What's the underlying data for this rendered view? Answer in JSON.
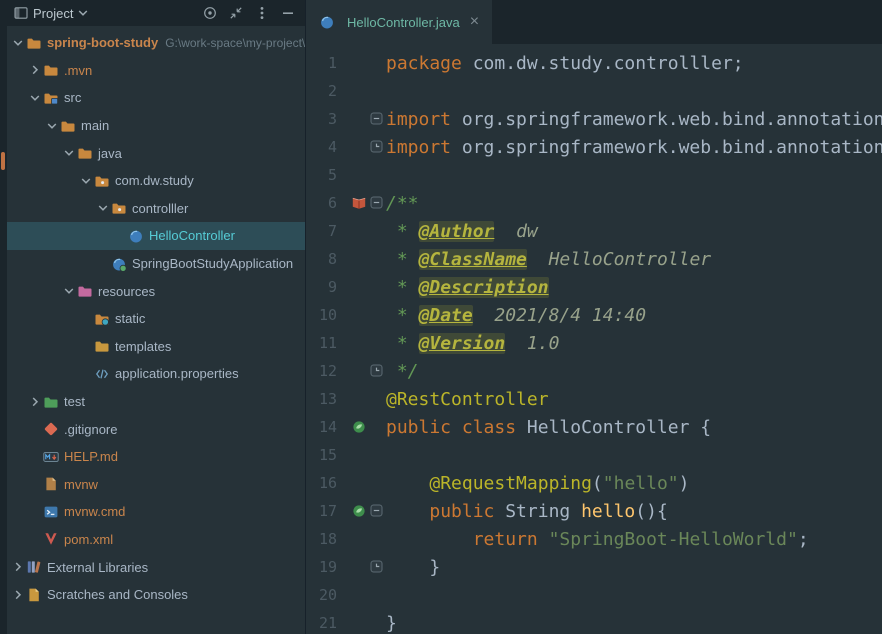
{
  "colors": {
    "keyword": "#CC7832",
    "string": "#6A8759",
    "annotation": "#BBB529",
    "comment": "#629755",
    "selection_bg": "#2D4D57",
    "selected_text": "#56CCD6",
    "orange_item": "#C9854C",
    "tab_title": "#6EB8A5",
    "editor_bg": "#263238"
  },
  "project_panel": {
    "title": "Project",
    "header_icons": [
      {
        "id": "locate",
        "name": "locate-icon"
      },
      {
        "id": "collapse-all",
        "name": "collapse-all-icon"
      },
      {
        "id": "more-options",
        "name": "more-options-icon"
      },
      {
        "id": "hide-panel",
        "name": "hide-panel-icon"
      }
    ],
    "tree": [
      {
        "label": "spring-boot-study",
        "path_suffix": "G:\\work-space\\my-project\\sp",
        "depth": 0,
        "chevron": "down",
        "icon": "folder",
        "color": "orange",
        "bold": true
      },
      {
        "label": ".mvn",
        "depth": 1,
        "chevron": "right",
        "icon": "folder",
        "color": "orange"
      },
      {
        "label": "src",
        "depth": 1,
        "chevron": "down",
        "icon": "folder-src",
        "color": "default"
      },
      {
        "label": "main",
        "depth": 2,
        "chevron": "down",
        "icon": "folder",
        "color": "default"
      },
      {
        "label": "java",
        "depth": 3,
        "chevron": "down",
        "icon": "folder",
        "color": "default"
      },
      {
        "label": "com.dw.study",
        "depth": 4,
        "chevron": "down",
        "icon": "package",
        "color": "default"
      },
      {
        "label": "controlller",
        "depth": 5,
        "chevron": "down",
        "icon": "package",
        "color": "default"
      },
      {
        "label": "HelloController",
        "depth": 6,
        "chevron": "none",
        "icon": "class",
        "color": "default",
        "selected": true
      },
      {
        "label": "SpringBootStudyApplication",
        "depth": 5,
        "chevron": "none",
        "icon": "class-spring",
        "color": "default"
      },
      {
        "label": "resources",
        "depth": 3,
        "chevron": "down",
        "icon": "folder-resources",
        "color": "default"
      },
      {
        "label": "static",
        "depth": 4,
        "chevron": "none",
        "icon": "folder-static",
        "color": "default"
      },
      {
        "label": "templates",
        "depth": 4,
        "chevron": "none",
        "icon": "folder-templates",
        "color": "default"
      },
      {
        "label": "application.properties",
        "depth": 4,
        "chevron": "none",
        "icon": "properties",
        "color": "default"
      },
      {
        "label": "test",
        "depth": 1,
        "chevron": "right",
        "icon": "folder-test",
        "color": "default"
      },
      {
        "label": ".gitignore",
        "depth": 1,
        "chevron": "none",
        "icon": "git",
        "color": "default"
      },
      {
        "label": "HELP.md",
        "depth": 1,
        "chevron": "none",
        "icon": "markdown",
        "color": "orange"
      },
      {
        "label": "mvnw",
        "depth": 1,
        "chevron": "none",
        "icon": "file",
        "color": "orange"
      },
      {
        "label": "mvnw.cmd",
        "depth": 1,
        "chevron": "none",
        "icon": "cmd",
        "color": "orange"
      },
      {
        "label": "pom.xml",
        "depth": 1,
        "chevron": "none",
        "icon": "maven",
        "color": "orange"
      },
      {
        "label": "External Libraries",
        "depth": 0,
        "chevron": "right",
        "icon": "libraries",
        "color": "default"
      },
      {
        "label": "Scratches and Consoles",
        "depth": 0,
        "chevron": "right",
        "icon": "scratches",
        "color": "default"
      }
    ]
  },
  "editor": {
    "tab": {
      "title": "HelloController.java",
      "close_glyph": "×",
      "icon": "class"
    },
    "lines": [
      {
        "n": "1",
        "seg": [
          [
            "kw",
            "package "
          ],
          [
            "pl",
            "com.dw.study.controlller;"
          ]
        ]
      },
      {
        "n": "2",
        "seg": []
      },
      {
        "n": "3",
        "fold": "start",
        "seg": [
          [
            "kw",
            "import "
          ],
          [
            "pl",
            "org.springframework.web.bind.annotation"
          ]
        ]
      },
      {
        "n": "4",
        "fold": "end",
        "seg": [
          [
            "kw",
            "import "
          ],
          [
            "pl",
            "org.springframework.web.bind.annotation"
          ]
        ]
      },
      {
        "n": "5",
        "seg": []
      },
      {
        "n": "6",
        "gutter": "book",
        "fold": "start",
        "seg": [
          [
            "cm",
            "/**"
          ]
        ]
      },
      {
        "n": "7",
        "seg": [
          [
            "cm",
            " * "
          ],
          [
            "tag",
            "@Author"
          ],
          [
            "cm",
            "  "
          ],
          [
            "tv",
            "dw"
          ]
        ]
      },
      {
        "n": "8",
        "seg": [
          [
            "cm",
            " * "
          ],
          [
            "tag",
            "@ClassName"
          ],
          [
            "cm",
            "  "
          ],
          [
            "tv",
            "HelloController"
          ]
        ]
      },
      {
        "n": "9",
        "seg": [
          [
            "cm",
            " * "
          ],
          [
            "tag",
            "@Description"
          ]
        ]
      },
      {
        "n": "10",
        "seg": [
          [
            "cm",
            " * "
          ],
          [
            "tag",
            "@Date"
          ],
          [
            "cm",
            "  "
          ],
          [
            "tv",
            "2021/8/4 14:40"
          ]
        ]
      },
      {
        "n": "11",
        "seg": [
          [
            "cm",
            " * "
          ],
          [
            "tag",
            "@Version"
          ],
          [
            "cm",
            "  "
          ],
          [
            "tv",
            "1.0"
          ]
        ]
      },
      {
        "n": "12",
        "fold": "end",
        "seg": [
          [
            "cm",
            " */"
          ]
        ]
      },
      {
        "n": "13",
        "seg": [
          [
            "ann",
            "@RestController"
          ]
        ]
      },
      {
        "n": "14",
        "gutter": "spring",
        "seg": [
          [
            "kw",
            "public class "
          ],
          [
            "pl",
            "HelloController {"
          ]
        ]
      },
      {
        "n": "15",
        "seg": []
      },
      {
        "n": "16",
        "seg": [
          [
            "pl",
            "    "
          ],
          [
            "ann",
            "@RequestMapping"
          ],
          [
            "pl",
            "("
          ],
          [
            "str",
            "\"hello\""
          ],
          [
            "pl",
            ")"
          ]
        ]
      },
      {
        "n": "17",
        "gutter": "spring",
        "fold": "start",
        "seg": [
          [
            "pl",
            "    "
          ],
          [
            "kw",
            "public "
          ],
          [
            "pl",
            "String "
          ],
          [
            "fn",
            "hello"
          ],
          [
            "pl",
            "(){"
          ]
        ]
      },
      {
        "n": "18",
        "seg": [
          [
            "pl",
            "        "
          ],
          [
            "kw",
            "return "
          ],
          [
            "str",
            "\"SpringBoot-HelloWorld\""
          ],
          [
            "pl",
            ";"
          ]
        ]
      },
      {
        "n": "19",
        "fold": "end",
        "seg": [
          [
            "pl",
            "    }"
          ]
        ]
      },
      {
        "n": "20",
        "seg": []
      },
      {
        "n": "21",
        "seg": [
          [
            "pl",
            "}"
          ]
        ]
      }
    ]
  }
}
